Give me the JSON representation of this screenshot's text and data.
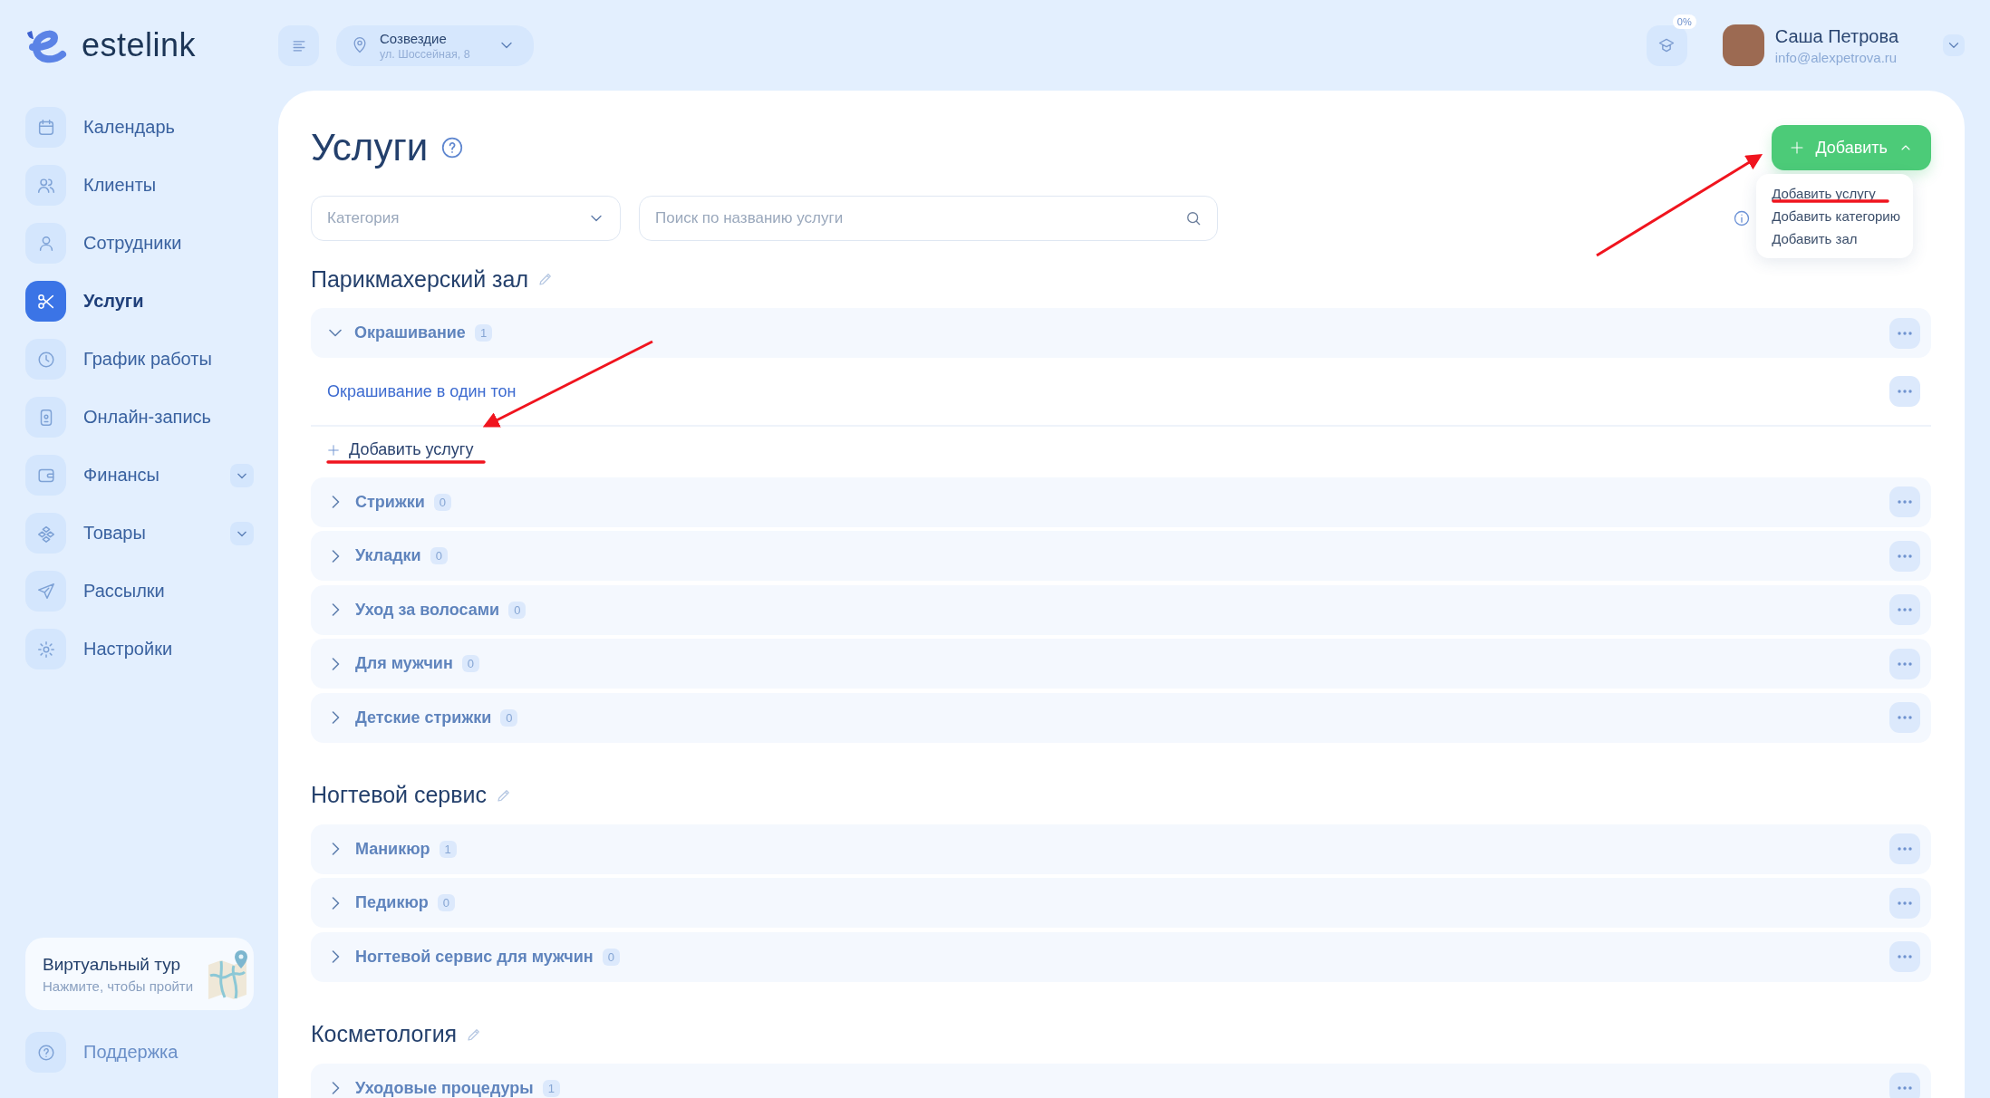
{
  "logo": {
    "text": "estelink"
  },
  "nav": [
    {
      "label": "Календарь",
      "selected": false,
      "submenu": false
    },
    {
      "label": "Клиенты",
      "selected": false,
      "submenu": false
    },
    {
      "label": "Сотрудники",
      "selected": false,
      "submenu": false
    },
    {
      "label": "Услуги",
      "selected": true,
      "submenu": false
    },
    {
      "label": "График работы",
      "selected": false,
      "submenu": false
    },
    {
      "label": "Онлайн-запись",
      "selected": false,
      "submenu": false
    },
    {
      "label": "Финансы",
      "selected": false,
      "submenu": true
    },
    {
      "label": "Товары",
      "selected": false,
      "submenu": true
    },
    {
      "label": "Рассылки",
      "selected": false,
      "submenu": false
    },
    {
      "label": "Настройки",
      "selected": false,
      "submenu": false
    }
  ],
  "tour": {
    "title": "Виртуальный тур",
    "subtitle": "Нажмите, чтобы пройти"
  },
  "support": {
    "label": "Поддержка"
  },
  "location": {
    "name": "Созвездие",
    "address": "ул. Шоссейная, 8"
  },
  "course": {
    "progress": "0%"
  },
  "user": {
    "name": "Саша Петрова",
    "email": "info@alexpetrova.ru"
  },
  "page": {
    "title": "Услуги"
  },
  "add_button": {
    "label": "Добавить",
    "expanded": true
  },
  "add_menu": [
    {
      "label": "Добавить услугу"
    },
    {
      "label": "Добавить категорию"
    },
    {
      "label": "Добавить зал"
    }
  ],
  "filters": {
    "category_placeholder": "Категория",
    "search_placeholder": "Поиск по названию услуги"
  },
  "sections": [
    {
      "title": "Парикмахерский зал",
      "categories": [
        {
          "name": "Окрашивание",
          "count": "1",
          "expanded": true,
          "services": [
            {
              "name": "Окрашивание в один тон"
            }
          ],
          "add_label": "Добавить услугу"
        },
        {
          "name": "Стрижки",
          "count": "0",
          "expanded": false
        },
        {
          "name": "Укладки",
          "count": "0",
          "expanded": false
        },
        {
          "name": "Уход за волосами",
          "count": "0",
          "expanded": false
        },
        {
          "name": "Для мужчин",
          "count": "0",
          "expanded": false
        },
        {
          "name": "Детские стрижки",
          "count": "0",
          "expanded": false
        }
      ]
    },
    {
      "title": "Ногтевой сервис",
      "categories": [
        {
          "name": "Маникюр",
          "count": "1",
          "expanded": false
        },
        {
          "name": "Педикюр",
          "count": "0",
          "expanded": false
        },
        {
          "name": "Ногтевой сервис для мужчин",
          "count": "0",
          "expanded": false
        }
      ]
    },
    {
      "title": "Косметология",
      "categories": [
        {
          "name": "Уходовые процедуры",
          "count": "1",
          "expanded": false
        }
      ]
    }
  ]
}
